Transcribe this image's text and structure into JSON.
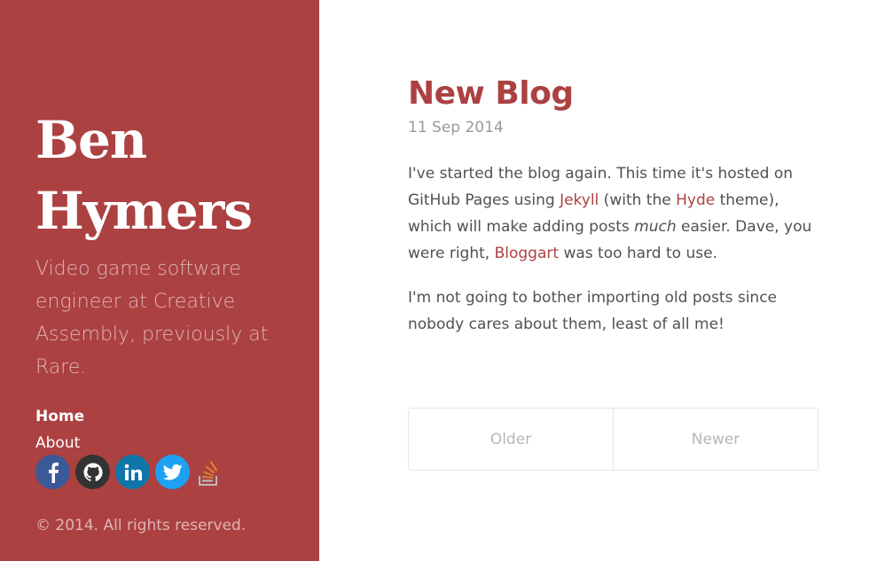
{
  "sidebar": {
    "title_line1": "Ben",
    "title_line2": "Hymers",
    "lead": "Video game software engineer at Creative Assembly, previously at Rare.",
    "nav": [
      {
        "label": "Home",
        "active": true
      },
      {
        "label": "About",
        "active": false
      }
    ],
    "social": [
      {
        "icon": "facebook-icon",
        "color": "#3b5998"
      },
      {
        "icon": "github-icon",
        "color": "#333333"
      },
      {
        "icon": "linkedin-icon",
        "color": "#0e76a8"
      },
      {
        "icon": "twitter-icon",
        "color": "#1da1f2"
      },
      {
        "icon": "stackoverflow-icon",
        "color": "#f48024"
      }
    ],
    "copyright": "© 2014. All rights reserved."
  },
  "post": {
    "title": "New Blog",
    "date": "11 Sep 2014",
    "p1": {
      "t1": "I've started the blog again. This time it's hosted on GitHub Pages using ",
      "link_jekyll": "Jekyll",
      "t2": " (with the ",
      "link_hyde": "Hyde",
      "t3": " theme), which will make adding posts ",
      "em": "much",
      "t4": " easier. Dave, you were right, ",
      "link_bloggart": "Bloggart",
      "t5": " was too hard to use."
    },
    "p2": "I'm not going to bother importing old posts since nobody cares about them, least of all me!"
  },
  "pagination": {
    "older": "Older",
    "newer": "Newer"
  },
  "colors": {
    "accent": "#ac4142",
    "text": "#515151",
    "muted": "#9a9a9a"
  }
}
